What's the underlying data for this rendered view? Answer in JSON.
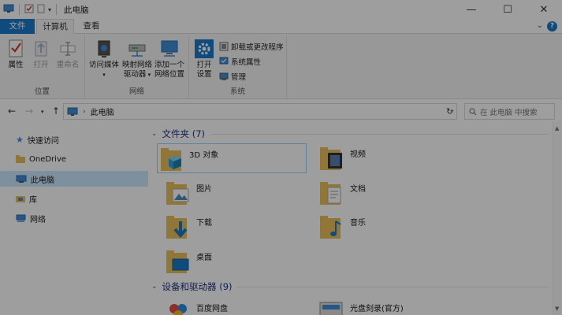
{
  "window": {
    "title": "此电脑",
    "controls": {
      "minimize": "—",
      "maximize": "☐",
      "close": "✕"
    }
  },
  "tabs": {
    "file": "文件",
    "computer": "计算机",
    "view": "查看",
    "collapse": "⌄",
    "help": "?"
  },
  "ribbon": {
    "location": {
      "label": "位置",
      "properties": "属性",
      "open": "打开",
      "rename": "重命名"
    },
    "network": {
      "label": "网络",
      "access_media": "访问媒体",
      "map_drive_l1": "映射网络",
      "map_drive_l2": "驱动器",
      "add_location_l1": "添加一个",
      "add_location_l2": "网络位置"
    },
    "system": {
      "label": "系统",
      "open_settings_l1": "打开",
      "open_settings_l2": "设置",
      "uninstall": "卸载或更改程序",
      "system_properties": "系统属性",
      "manage": "管理"
    }
  },
  "address": {
    "path": "此电脑",
    "search_placeholder": "在 此电脑 中搜索"
  },
  "sidebar": {
    "items": [
      {
        "label": "快速访问",
        "icon": "star-icon"
      },
      {
        "label": "OneDrive",
        "icon": "onedrive-icon"
      },
      {
        "label": "此电脑",
        "icon": "computer-icon"
      },
      {
        "label": "库",
        "icon": "library-icon"
      },
      {
        "label": "网络",
        "icon": "network-icon"
      }
    ]
  },
  "main": {
    "folders_header": "文件夹 (7)",
    "folders": [
      {
        "label": "3D 对象"
      },
      {
        "label": "视频"
      },
      {
        "label": "图片"
      },
      {
        "label": "文档"
      },
      {
        "label": "下载"
      },
      {
        "label": "音乐"
      },
      {
        "label": "桌面"
      }
    ],
    "drives_header": "设备和驱动器 (9)",
    "drives": [
      {
        "label": "百度网盘"
      },
      {
        "label": "光盘刻录(官方)"
      }
    ]
  },
  "colors": {
    "accent": "#1979ca",
    "selection": "#cce8ff",
    "header_text": "#1e3287",
    "folder": "#e8c15a"
  }
}
